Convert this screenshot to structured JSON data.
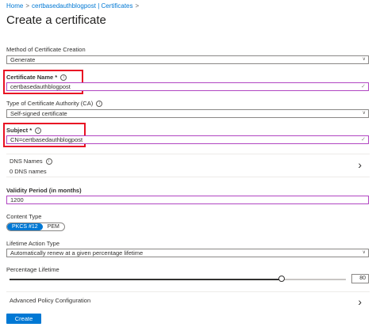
{
  "breadcrumb": {
    "home": "Home",
    "vault": "certbasedauthblogpost | Certificates"
  },
  "page": {
    "title": "Create a certificate"
  },
  "method": {
    "label": "Method of Certificate Creation",
    "value": "Generate"
  },
  "cert_name": {
    "label": "Certificate Name",
    "required_mark": "*",
    "value": "certbasedauthblogpost"
  },
  "ca_type": {
    "label": "Type of Certificate Authority (CA)",
    "value": "Self-signed certificate"
  },
  "subject": {
    "label": "Subject",
    "required_mark": "*",
    "value": "CN=certbasedauthblogpost"
  },
  "dns": {
    "label": "DNS Names",
    "value": "0 DNS names"
  },
  "validity": {
    "label": "Validity Period (in months)",
    "value": "1200"
  },
  "content_type": {
    "label": "Content Type",
    "options": [
      "PKCS #12",
      "PEM"
    ],
    "selected": "PKCS #12"
  },
  "lifetime_action": {
    "label": "Lifetime Action Type",
    "value": "Automatically renew at a given percentage lifetime"
  },
  "percentage": {
    "label": "Percentage Lifetime",
    "value": "80",
    "fraction": 0.8
  },
  "advanced": {
    "label": "Advanced Policy Configuration"
  },
  "actions": {
    "create": "Create"
  },
  "colors": {
    "accent": "#0078d4",
    "highlight_border": "#e81123",
    "focus_border": "#b146c2"
  }
}
